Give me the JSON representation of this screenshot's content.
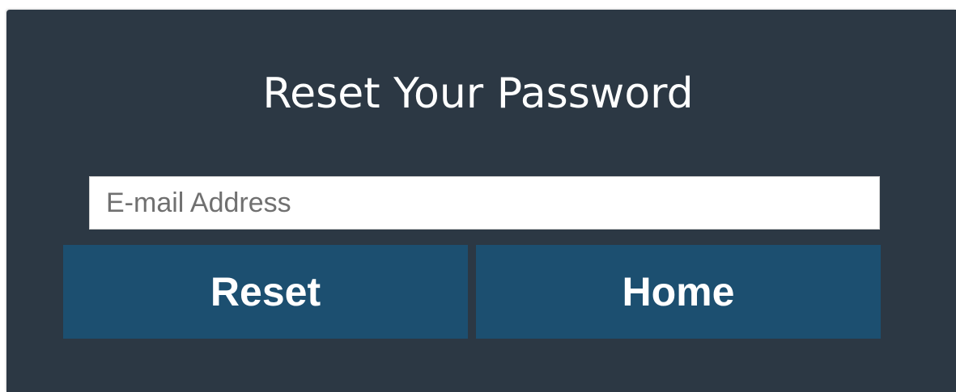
{
  "form": {
    "title": "Reset Your Password",
    "email_placeholder": "E-mail Address",
    "email_value": "",
    "reset_label": "Reset",
    "home_label": "Home"
  },
  "colors": {
    "panel_background": "#2c3844",
    "button_background": "#1c4f70",
    "text": "#ffffff"
  }
}
